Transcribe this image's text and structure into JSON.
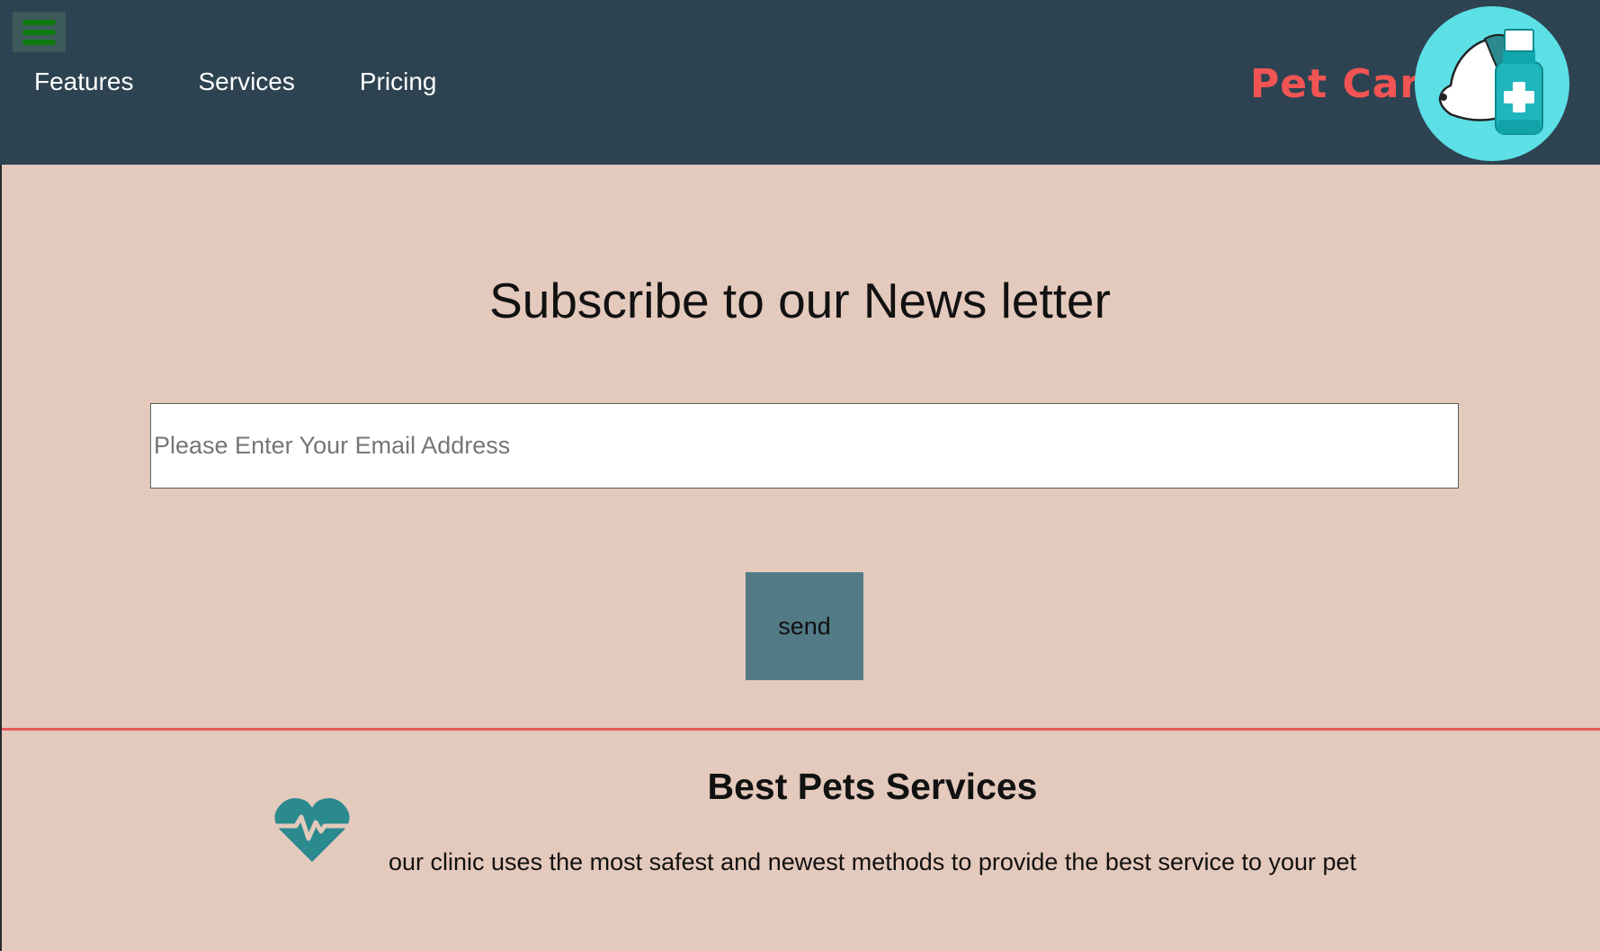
{
  "nav": {
    "links": [
      "Features",
      "Services",
      "Pricing"
    ],
    "brand": "Pet Care"
  },
  "icons": {
    "menu": "hamburger-menu-icon",
    "logo": "pet-care-logo",
    "service": "heartbeat-icon"
  },
  "newsletter": {
    "title": "Subscribe to our News letter",
    "email_placeholder": "Please Enter Your Email Address",
    "email_value": "",
    "send_label": "send"
  },
  "services": {
    "title": "Best Pets Services",
    "description": "our clinic uses the most safest and newest methods to provide the best service to your pet"
  },
  "colors": {
    "navbar": "#2e4351",
    "page_background": "#e4c9bd",
    "brand": "#f25454",
    "button": "#527a87",
    "divider": "#e85a5a",
    "accent_teal": "#2a8a8e",
    "logo_circle": "#5ce0e6"
  }
}
